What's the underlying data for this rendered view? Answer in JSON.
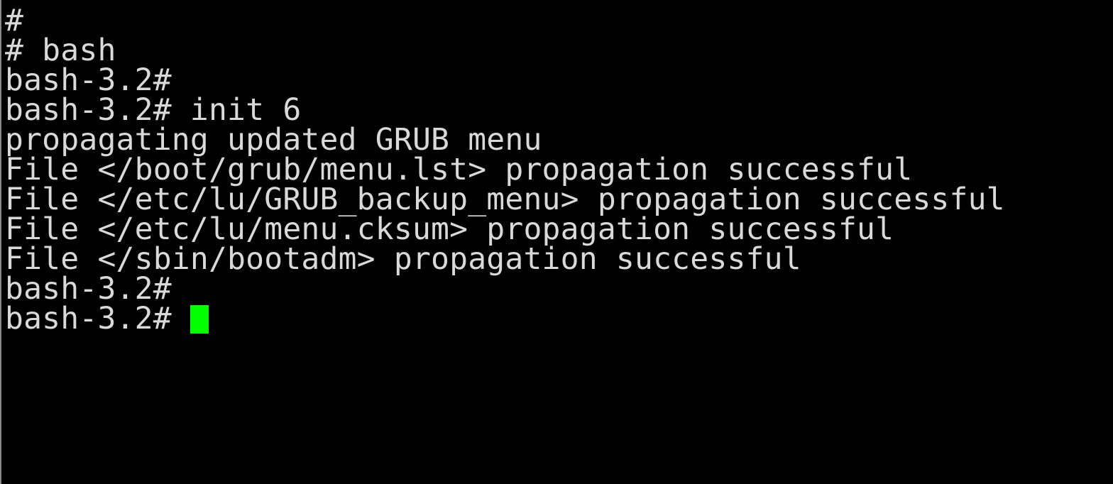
{
  "terminal": {
    "lines": [
      "#",
      "# bash",
      "bash-3.2#",
      "bash-3.2# init 6",
      "propagating updated GRUB menu",
      "File </boot/grub/menu.lst> propagation successful",
      "File </etc/lu/GRUB_backup_menu> propagation successful",
      "File </etc/lu/menu.cksum> propagation successful",
      "File </sbin/bootadm> propagation successful",
      "bash-3.2#",
      "bash-3.2# "
    ],
    "cursor_color": "#00ff00",
    "text_color": "#d9d9d9",
    "background_color": "#000000"
  }
}
